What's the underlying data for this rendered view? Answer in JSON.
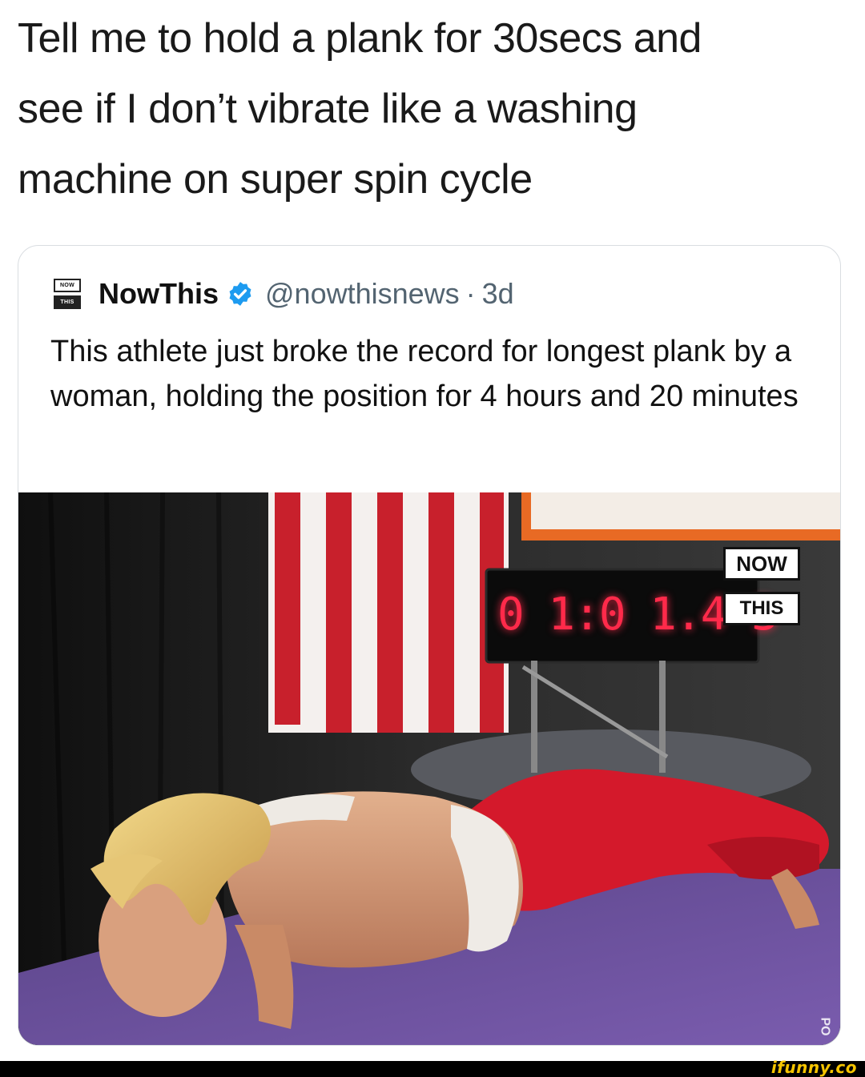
{
  "caption": {
    "line1": "Tell me to hold a plank for 30secs and",
    "line2": "see if I don’t vibrate like a washing",
    "line3": "machine on super spin cycle"
  },
  "tweet": {
    "avatar_top": "NOW",
    "avatar_bottom": "THIS",
    "display_name": "NowThis",
    "verified": true,
    "handle": "@nowthisnews",
    "separator": "·",
    "age": "3d",
    "text": "This athlete just broke the record for longest plank by a woman, holding the position for 4 hours and 20 minutes"
  },
  "media": {
    "timer_display": "0 1:0 1.4 3",
    "logo_top": "NOW",
    "logo_bottom": "THIS",
    "corner_mark": "PO"
  },
  "watermark": {
    "text": "ifunny.co",
    "color": "#f5c400"
  },
  "colors": {
    "verified_blue": "#1d9bf0",
    "timer_red": "#ff2a4a",
    "leggings_red": "#d4192b",
    "mat_purple": "#6a4f9a"
  }
}
